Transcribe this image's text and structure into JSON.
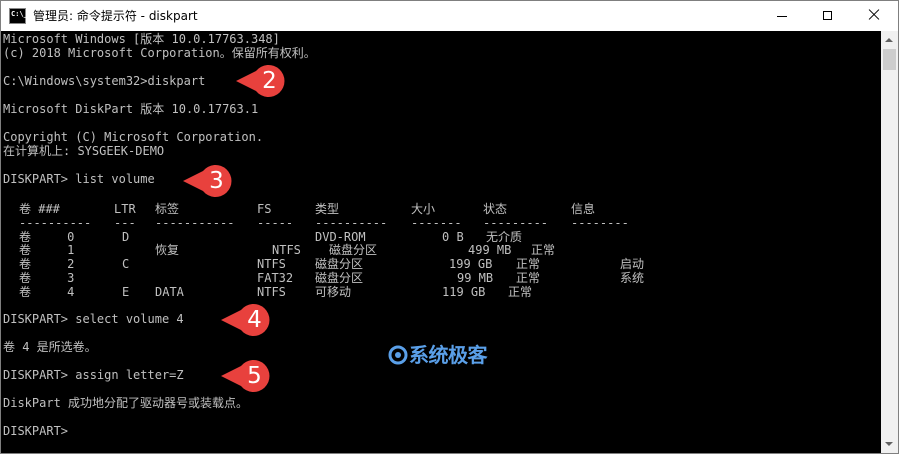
{
  "window": {
    "title": "管理员: 命令提示符 - diskpart",
    "icon_label": "C:\\_",
    "controls": {
      "minimize": "minimize",
      "maximize": "maximize",
      "close": "close"
    }
  },
  "console": {
    "lines": [
      "Microsoft Windows [版本 10.0.17763.348]",
      "(c) 2018 Microsoft Corporation。保留所有权利。",
      "",
      "C:\\Windows\\system32>diskpart",
      "",
      "Microsoft DiskPart 版本 10.0.17763.1",
      "",
      "Copyright (C) Microsoft Corporation.",
      "在计算机上: SYSGEEK-DEMO",
      "",
      "DISKPART> list volume",
      "",
      "",
      "",
      "",
      "",
      "",
      "",
      "",
      "",
      "DISKPART> select volume 4",
      "",
      "卷 4 是所选卷。",
      "",
      "DISKPART> assign letter=Z",
      "",
      "DiskPart 成功地分配了驱动器号或装载点。",
      "",
      "DISKPART>"
    ],
    "volume_table": {
      "headers": [
        "卷 ###",
        "LTR",
        "标签",
        "FS",
        "类型",
        "大小",
        "状态",
        "信息"
      ],
      "separator": [
        "----------",
        "---",
        "-----------",
        "-----",
        "----------",
        "-------",
        "---------",
        "--------"
      ],
      "rows": [
        [
          "卷     0",
          "D",
          "",
          "",
          "DVD-ROM",
          "0 B",
          "无介质",
          ""
        ],
        [
          "卷     1",
          "",
          "恢复",
          "NTFS",
          "磁盘分区",
          "499 MB",
          "正常",
          ""
        ],
        [
          "卷     2",
          "C",
          "",
          "NTFS",
          "磁盘分区",
          "199 GB",
          "正常",
          "启动"
        ],
        [
          "卷     3",
          "",
          "",
          "FAT32",
          "磁盘分区",
          "99 MB",
          "正常",
          "系统"
        ],
        [
          "卷     4",
          "E",
          "DATA",
          "NTFS",
          "可移动",
          "119 GB",
          "正常",
          ""
        ]
      ]
    }
  },
  "annotations": {
    "markers": [
      "2",
      "3",
      "4",
      "5"
    ],
    "color": "#e8413d"
  },
  "watermark": {
    "text": "系统极客",
    "color": "#5a9fe8"
  }
}
